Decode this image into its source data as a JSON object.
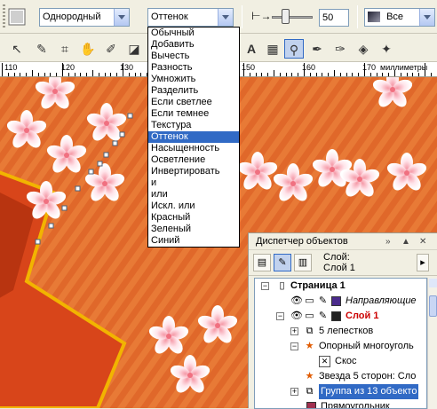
{
  "propbar": {
    "blend_type": "Однородный",
    "blend_mode": "Оттенок",
    "opacity_value": "50",
    "target": "Все"
  },
  "dropdown": {
    "items": [
      "Обычный",
      "Добавить",
      "Вычесть",
      "Разность",
      "Умножить",
      "Разделить",
      "Если светлее",
      "Если темнее",
      "Текстура",
      "Оттенок",
      "Насыщенность",
      "Осветление",
      "Инвертировать",
      "и",
      "или",
      "Искл. или",
      "Красный",
      "Зеленый",
      "Синий"
    ],
    "selected": "Оттенок"
  },
  "ruler": {
    "labels": [
      "110",
      "120",
      "130",
      "150",
      "160",
      "170"
    ],
    "unit": "миллиметры"
  },
  "object_manager": {
    "title": "Диспетчер объектов",
    "layer_label": "Слой:",
    "layer_name": "Слой 1",
    "tree": [
      {
        "label": "Страница 1"
      },
      {
        "label": "Направляющие"
      },
      {
        "label": "Слой 1"
      },
      {
        "label": "5 лепестков"
      },
      {
        "label": "Опорный многоуголь"
      },
      {
        "label": "Скос"
      },
      {
        "label": "Звезда  5 сторон: Сло"
      },
      {
        "label": "Группа из 13 объекто"
      },
      {
        "label": "Прямоугольник"
      }
    ]
  },
  "colors": {
    "canvas_bg": "#e0682a",
    "star": "#d8451a",
    "star_border": "#f2b400",
    "selection": "#316ac5",
    "layer_red": "#cc0000"
  }
}
